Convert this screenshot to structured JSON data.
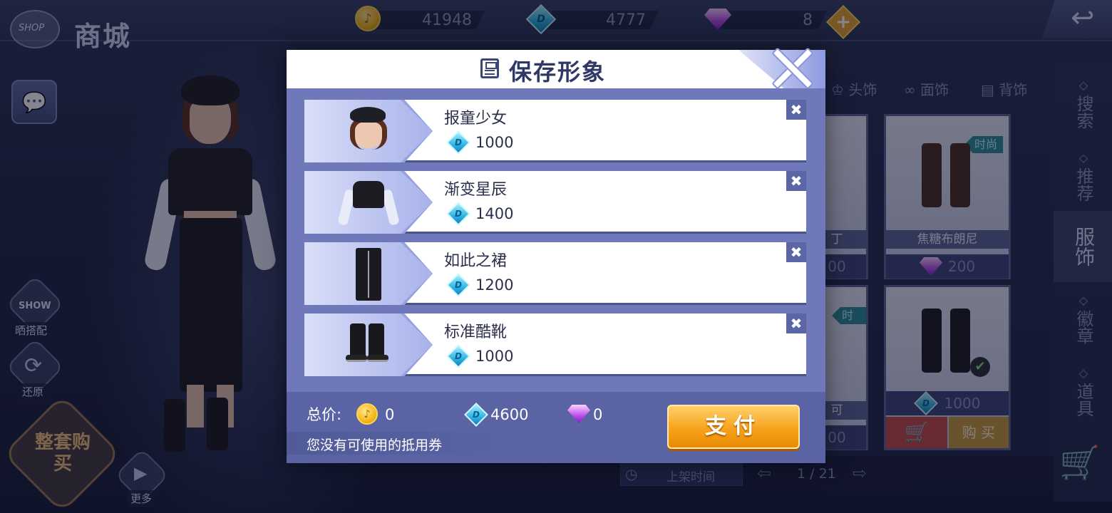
{
  "header": {
    "shop_en": "SHOP",
    "shop_title": "商城",
    "currencies": [
      {
        "icon": "gold-coin-icon",
        "value": "41948"
      },
      {
        "icon": "blue-diamond-icon",
        "value": "4777"
      },
      {
        "icon": "purple-gem-icon",
        "value": "8"
      }
    ],
    "add_symbol": "+",
    "back_symbol": "↩"
  },
  "left_controls": {
    "chat_icon": "💬",
    "show_badge": "SHOW",
    "show_label": "晒搭配",
    "restore_label": "还原",
    "buy_set_label": "整套购买",
    "more_label": "更多"
  },
  "shop": {
    "tabs": [
      "头饰",
      "面饰",
      "背饰"
    ],
    "side_nav": [
      "搜索",
      "推荐",
      "服饰",
      "徽章",
      "道具"
    ],
    "cards": [
      {
        "name": "焦糖布朗尼",
        "tag": "时尚",
        "price": "200",
        "currency": "purple-gem-icon"
      },
      {
        "name": "",
        "tag": "",
        "price": "1000",
        "currency": "blue-diamond-icon",
        "buy_label": "购 买"
      }
    ],
    "partial_labels": [
      "丁",
      "00",
      "可",
      "00"
    ],
    "partial_tag": "时尚",
    "sort_label": "上架时间",
    "pager": "1 / 21"
  },
  "dialog": {
    "title": "保存形象",
    "items": [
      {
        "name": "报童少女",
        "price": "1000",
        "picture": "newsboy-cap-head"
      },
      {
        "name": "渐变星辰",
        "price": "1400",
        "picture": "black-crop-top"
      },
      {
        "name": "如此之裙",
        "price": "1200",
        "picture": "black-zip-skirt"
      },
      {
        "name": "标准酷靴",
        "price": "1000",
        "picture": "black-boots"
      }
    ],
    "remove_symbol": "✖",
    "total_label": "总价:",
    "totals": {
      "gold": "0",
      "diamond": "4600",
      "gem": "0"
    },
    "voucher_note": "您没有可使用的抵用券",
    "pay_label": "支付"
  },
  "colors": {
    "accent_orange": "#f7a31b",
    "dialog_blue": "#6f79b9",
    "title_text": "#2f3866"
  }
}
